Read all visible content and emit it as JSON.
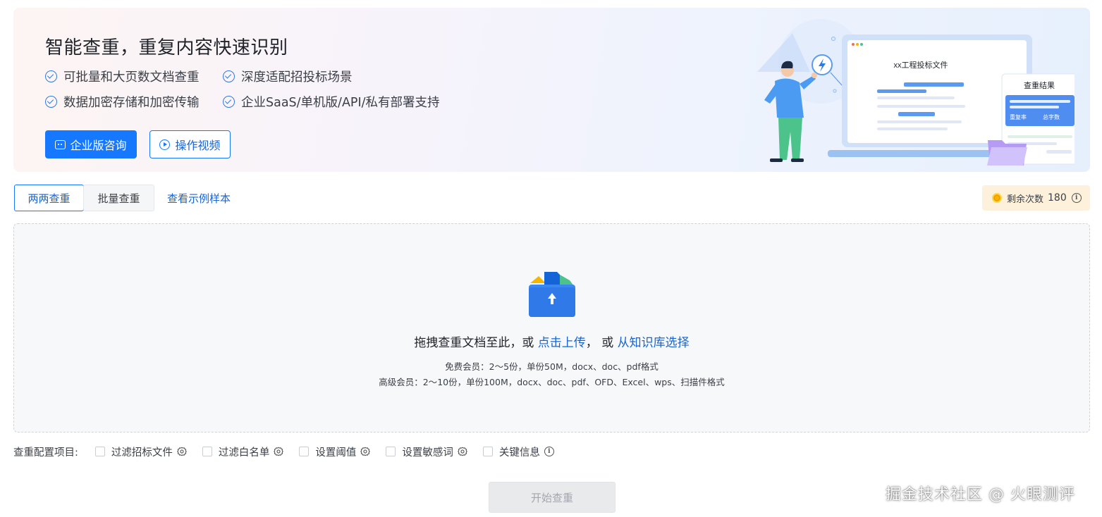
{
  "banner": {
    "title": "智能查重，重复内容快速识别",
    "features": [
      "可批量和大页数文档查重",
      "深度适配招投标场景",
      "数据加密存储和加密传输",
      "企业SaaS/单机版/API/私有部署支持"
    ],
    "consult_button": "企业版咨询",
    "video_button": "操作视频",
    "illustration": {
      "doc_title": "xx工程投标文件",
      "result_title": "查重结果",
      "result_labels": [
        "重复率",
        "总字数"
      ]
    }
  },
  "tabs": [
    {
      "label": "两两查重",
      "active": true
    },
    {
      "label": "批量查重",
      "active": false
    }
  ],
  "sample_link": "查看示例样本",
  "remaining": {
    "label": "剩余次数",
    "count": "180"
  },
  "upload": {
    "prefix": "拖拽查重文档至此，或",
    "click_upload": "点击上传",
    "separator": "，  或",
    "kb_select": "从知识库选择",
    "free_note": "免费会员：2～5份，单份50M，docx、doc、pdf格式",
    "premium_note": "高级会员：2～10份，单份100M，docx、doc、pdf、OFD、Excel、wps、扫描件格式"
  },
  "config": {
    "label": "查重配置项目:",
    "items": [
      "过滤招标文件",
      "过滤白名单",
      "设置阈值",
      "设置敏感词",
      "关键信息"
    ]
  },
  "start_button": "开始查重",
  "watermark": "掘金技术社区 @ 火眼测评",
  "colors": {
    "accent": "#1677ff",
    "link": "#1664d8",
    "coin": "#f7b500"
  }
}
